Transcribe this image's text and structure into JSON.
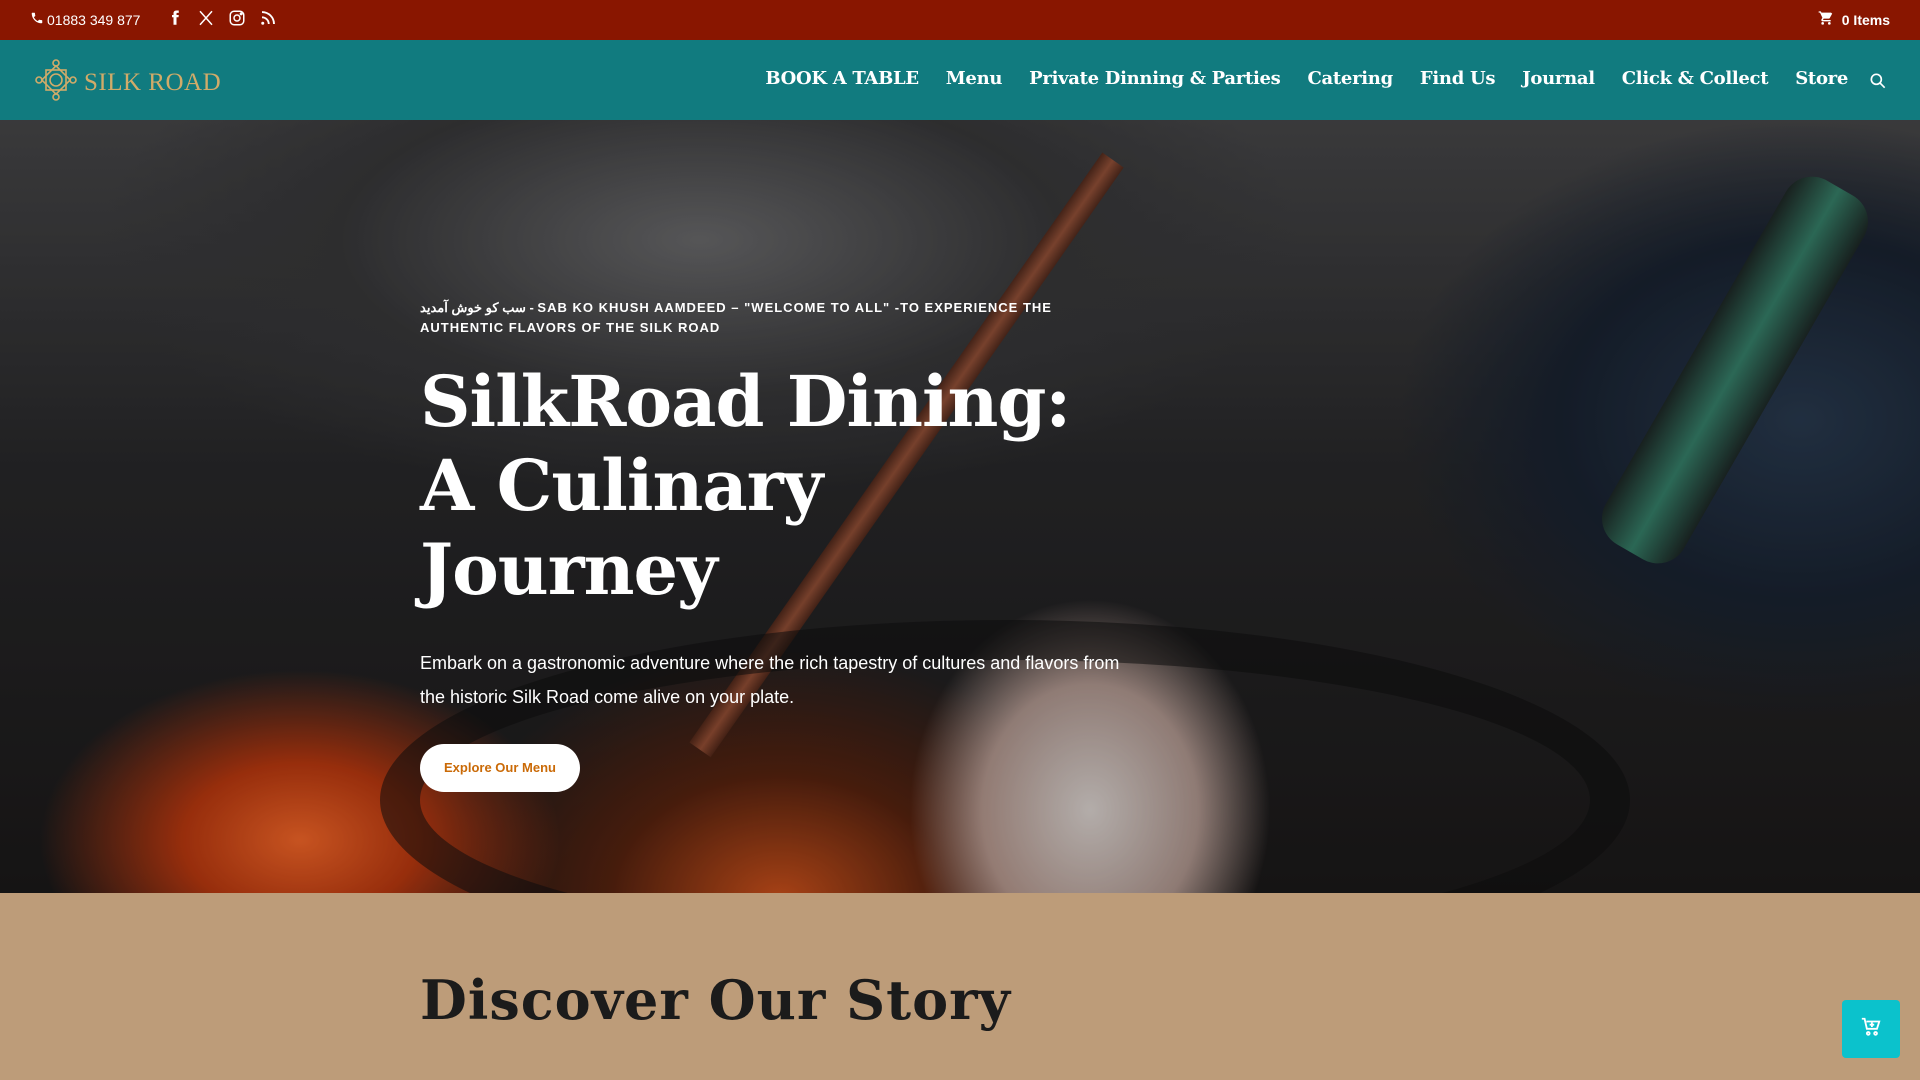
{
  "topbar": {
    "phone": "01883 349 877",
    "cart_label": "0 Items",
    "social": [
      "facebook-icon",
      "x-icon",
      "instagram-icon",
      "rss-icon"
    ]
  },
  "logo": {
    "text": "SILK ROAD"
  },
  "nav": {
    "items": [
      {
        "label": "BOOK A TABLE"
      },
      {
        "label": "Menu"
      },
      {
        "label": "Private Dinning & Parties"
      },
      {
        "label": "Catering"
      },
      {
        "label": "Find Us"
      },
      {
        "label": "Journal"
      },
      {
        "label": "Click & Collect"
      },
      {
        "label": "Store"
      }
    ]
  },
  "hero": {
    "kicker": "سب کو خوش آمدید - SAB KO KHUSH AAMDEED – \"WELCOME TO ALL\" -TO EXPERIENCE THE AUTHENTIC FLAVORS OF THE SILK ROAD",
    "title": "SilkRoad Dining: A Culinary Journey",
    "description": "Embark on a gastronomic adventure where the rich tapestry of cultures and flavors from the historic Silk Road come alive on your plate.",
    "button": "Explore Our Menu"
  },
  "story": {
    "title": "Discover Our Story"
  },
  "colors": {
    "topbar": "#891600",
    "nav": "#117b7f",
    "logo": "#d1ab69",
    "story_bg": "#bd9c79",
    "button_text": "#ca6a07",
    "float_cart": "#0bc2cc"
  }
}
